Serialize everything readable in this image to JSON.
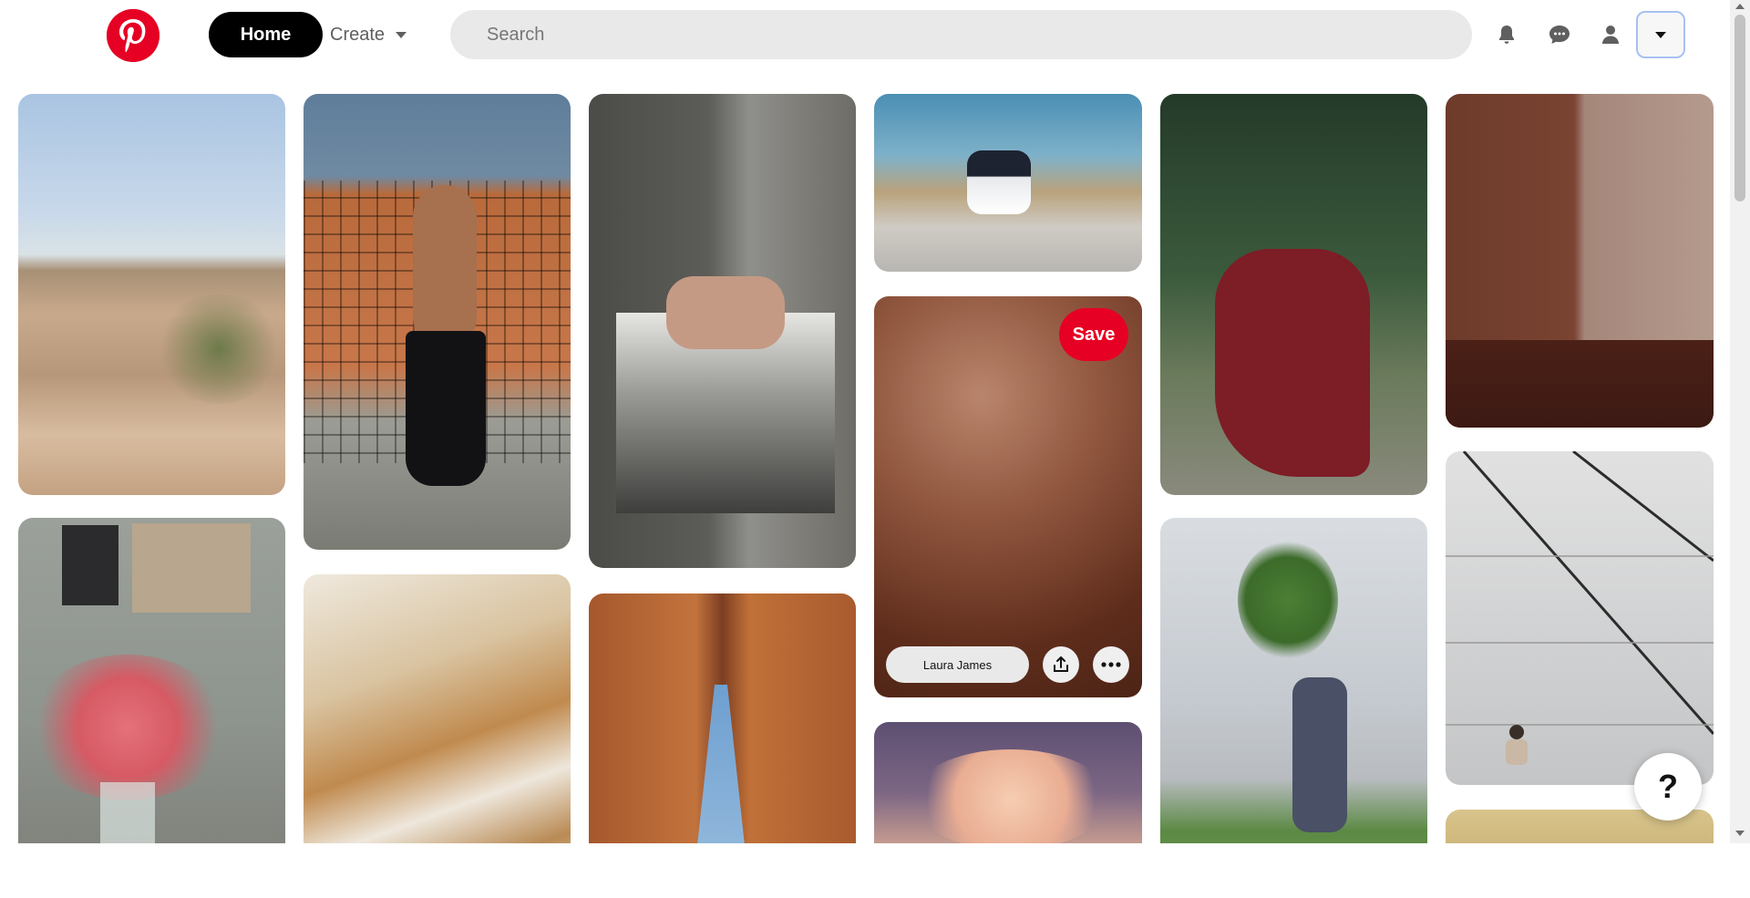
{
  "header": {
    "logo_label": "Pinterest",
    "home_label": "Home",
    "create_label": "Create",
    "search_placeholder": "Search",
    "icons": [
      "bell-icon",
      "chat-icon",
      "user-icon",
      "chevron-down-icon"
    ]
  },
  "hovered_pin": {
    "save_label": "Save",
    "source_label": "Laura James"
  },
  "help_label": "?",
  "pins": [
    {
      "name": "pin-desert-canyon",
      "subject": "desert canyon landscape"
    },
    {
      "name": "pin-pink-flowers",
      "subject": "pink flowers in vase"
    },
    {
      "name": "pin-dancer-lattice",
      "subject": "dancer by brick lattice"
    },
    {
      "name": "pin-white-terraces",
      "subject": "white travertine terraces"
    },
    {
      "name": "pin-holding-hands",
      "subject": "couple holding hands"
    },
    {
      "name": "pin-red-rock-arch",
      "subject": "red rock arch"
    },
    {
      "name": "pin-toy-van",
      "subject": "toy van on sand"
    },
    {
      "name": "pin-leaf-shadows",
      "subject": "leaf shadows"
    },
    {
      "name": "pin-clouds",
      "subject": "clouds at dusk"
    },
    {
      "name": "pin-woman-red-dress",
      "subject": "woman in red dress"
    },
    {
      "name": "pin-man-holding-tree",
      "subject": "man holding tree"
    },
    {
      "name": "pin-brick-wall",
      "subject": "brick wall with figure"
    },
    {
      "name": "pin-gray-wall",
      "subject": "woman sitting by gray wall"
    },
    {
      "name": "pin-building",
      "subject": "building facade"
    }
  ]
}
